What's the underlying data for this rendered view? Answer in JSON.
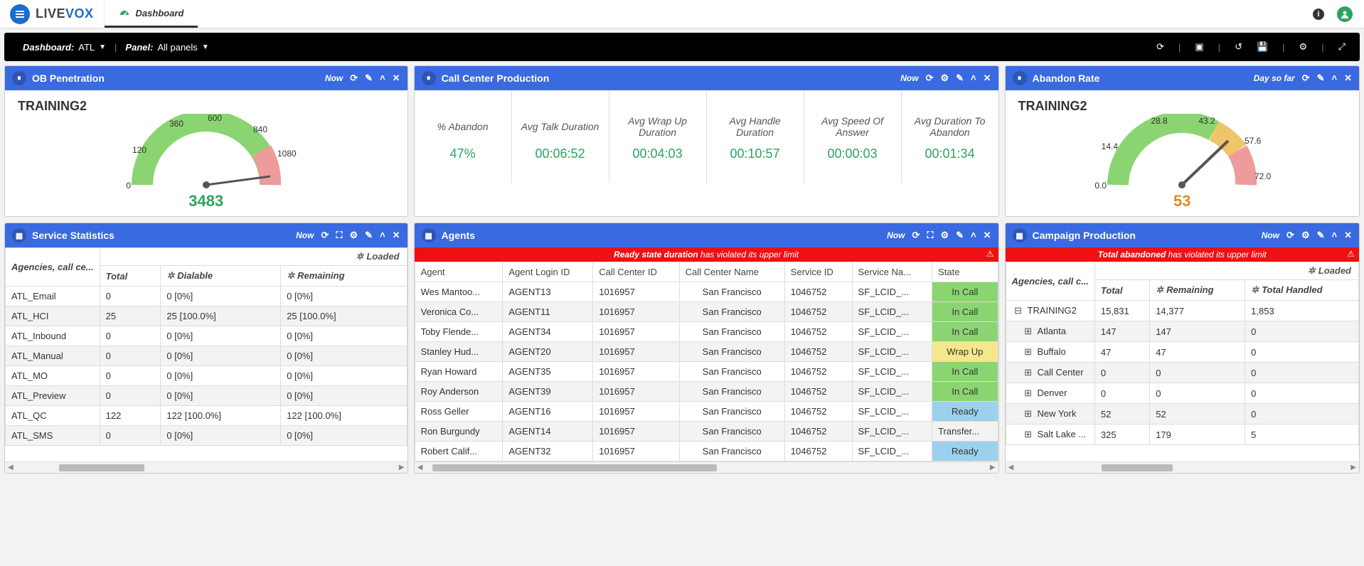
{
  "topnav": {
    "logo_live": "LIVE",
    "logo_vox": "VOX",
    "tab_label": "Dashboard"
  },
  "blackbar": {
    "dash_label": "Dashboard:",
    "dash_val": "ATL",
    "panel_label": "Panel:",
    "panel_val": "All panels"
  },
  "ob_panel": {
    "title": "OB Penetration",
    "time": "Now",
    "gtitle": "TRAINING2",
    "ticks": {
      "t0": "0",
      "t120": "120",
      "t360": "360",
      "t600": "600",
      "t840": "840",
      "t1080": "1080"
    },
    "value": "3483"
  },
  "cc_panel": {
    "title": "Call Center Production",
    "time": "Now",
    "cols": [
      {
        "h": "% Abandon",
        "v": "47%"
      },
      {
        "h": "Avg Talk Duration",
        "v": "00:06:52"
      },
      {
        "h": "Avg Wrap Up Duration",
        "v": "00:04:03"
      },
      {
        "h": "Avg Handle Duration",
        "v": "00:10:57"
      },
      {
        "h": "Avg Speed Of Answer",
        "v": "00:00:03"
      },
      {
        "h": "Avg Duration To Abandon",
        "v": "00:01:34"
      }
    ]
  },
  "ab_panel": {
    "title": "Abandon Rate",
    "time": "Day so far",
    "gtitle": "TRAINING2",
    "ticks": {
      "t0": "0.0",
      "t1": "14.4",
      "t2": "28.8",
      "t3": "43.2",
      "t4": "57.6",
      "t5": "72.0"
    },
    "value": "53"
  },
  "svc_panel": {
    "title": "Service Statistics",
    "time": "Now",
    "loaded": "Loaded",
    "corner": "Agencies, call ce...",
    "cols": {
      "total": "Total",
      "dial": "Dialable",
      "rem": "Remaining"
    },
    "rows": [
      {
        "n": "ATL_Email",
        "t": "0",
        "d": "0 [0%]",
        "r": "0 [0%]"
      },
      {
        "n": "ATL_HCI",
        "t": "25",
        "d": "25 [100.0%]",
        "r": "25 [100.0%]"
      },
      {
        "n": "ATL_Inbound",
        "t": "0",
        "d": "0 [0%]",
        "r": "0 [0%]"
      },
      {
        "n": "ATL_Manual",
        "t": "0",
        "d": "0 [0%]",
        "r": "0 [0%]"
      },
      {
        "n": "ATL_MO",
        "t": "0",
        "d": "0 [0%]",
        "r": "0 [0%]"
      },
      {
        "n": "ATL_Preview",
        "t": "0",
        "d": "0 [0%]",
        "r": "0 [0%]"
      },
      {
        "n": "ATL_QC",
        "t": "122",
        "d": "122 [100.0%]",
        "r": "122 [100.0%]"
      },
      {
        "n": "ATL_SMS",
        "t": "0",
        "d": "0 [0%]",
        "r": "0 [0%]"
      }
    ]
  },
  "ag_panel": {
    "title": "Agents",
    "time": "Now",
    "alert_b": "Ready state duration",
    "alert_r": "has violated its upper limit",
    "cols": {
      "agent": "Agent",
      "login": "Agent Login ID",
      "ccid": "Call Center ID",
      "ccname": "Call Center Name",
      "sid": "Service ID",
      "sname": "Service Na...",
      "state": "State"
    },
    "rows": [
      {
        "a": "Wes Mantoo...",
        "l": "AGENT13",
        "cc": "1016957",
        "cn": "San Francisco",
        "si": "1046752",
        "sn": "SF_LCID_...",
        "st": "In Call",
        "cls": "incell"
      },
      {
        "a": "Veronica Co...",
        "l": "AGENT11",
        "cc": "1016957",
        "cn": "San Francisco",
        "si": "1046752",
        "sn": "SF_LCID_...",
        "st": "In Call",
        "cls": "incell"
      },
      {
        "a": "Toby Flende...",
        "l": "AGENT34",
        "cc": "1016957",
        "cn": "San Francisco",
        "si": "1046752",
        "sn": "SF_LCID_...",
        "st": "In Call",
        "cls": "incell"
      },
      {
        "a": "Stanley Hud...",
        "l": "AGENT20",
        "cc": "1016957",
        "cn": "San Francisco",
        "si": "1046752",
        "sn": "SF_LCID_...",
        "st": "Wrap Up",
        "cls": "wrapup"
      },
      {
        "a": "Ryan Howard",
        "l": "AGENT35",
        "cc": "1016957",
        "cn": "San Francisco",
        "si": "1046752",
        "sn": "SF_LCID_...",
        "st": "In Call",
        "cls": "incell"
      },
      {
        "a": "Roy Anderson",
        "l": "AGENT39",
        "cc": "1016957",
        "cn": "San Francisco",
        "si": "1046752",
        "sn": "SF_LCID_...",
        "st": "In Call",
        "cls": "incell"
      },
      {
        "a": "Ross Geller",
        "l": "AGENT16",
        "cc": "1016957",
        "cn": "San Francisco",
        "si": "1046752",
        "sn": "SF_LCID_...",
        "st": "Ready",
        "cls": "ready"
      },
      {
        "a": "Ron Burgundy",
        "l": "AGENT14",
        "cc": "1016957",
        "cn": "San Francisco",
        "si": "1046752",
        "sn": "SF_LCID_...",
        "st": "Transfer...",
        "cls": ""
      },
      {
        "a": "Robert Calif...",
        "l": "AGENT32",
        "cc": "1016957",
        "cn": "San Francisco",
        "si": "1046752",
        "sn": "SF_LCID_...",
        "st": "Ready",
        "cls": "ready"
      }
    ]
  },
  "camp_panel": {
    "title": "Campaign Production",
    "time": "Now",
    "alert_b": "Total abandoned",
    "alert_r": "has violated its upper limit",
    "loaded": "Loaded",
    "corner": "Agencies, call c...",
    "cols": {
      "total": "Total",
      "rem": "Remaining",
      "th": "Total Handled"
    },
    "rows": [
      {
        "ic": "−",
        "n": "TRAINING2",
        "t": "15,831",
        "r": "14,377",
        "h": "1,853"
      },
      {
        "ic": "+",
        "n": "Atlanta",
        "t": "147",
        "r": "147",
        "h": "0"
      },
      {
        "ic": "+",
        "n": "Buffalo",
        "t": "47",
        "r": "47",
        "h": "0"
      },
      {
        "ic": "+",
        "n": "Call Center",
        "t": "0",
        "r": "0",
        "h": "0"
      },
      {
        "ic": "+",
        "n": "Denver",
        "t": "0",
        "r": "0",
        "h": "0"
      },
      {
        "ic": "+",
        "n": "New York",
        "t": "52",
        "r": "52",
        "h": "0"
      },
      {
        "ic": "+",
        "n": "Salt Lake ...",
        "t": "325",
        "r": "179",
        "h": "5"
      }
    ]
  },
  "chart_data": [
    {
      "type": "gauge",
      "title": "OB Penetration — TRAINING2",
      "range": [
        0,
        1080
      ],
      "ticks": [
        0,
        120,
        360,
        600,
        840,
        1080
      ],
      "zones": [
        {
          "from": 0,
          "to": 960,
          "color": "#8bd472"
        },
        {
          "from": 960,
          "to": 1080,
          "color": "#ed9b9b"
        }
      ],
      "value": 3483,
      "note": "value exceeds scale; needle pegged at max"
    },
    {
      "type": "gauge",
      "title": "Abandon Rate — TRAINING2",
      "range": [
        0,
        72.0
      ],
      "ticks": [
        0.0,
        14.4,
        28.8,
        43.2,
        57.6,
        72.0
      ],
      "zones": [
        {
          "from": 0,
          "to": 43.2,
          "color": "#8bd472"
        },
        {
          "from": 43.2,
          "to": 57.6,
          "color": "#f0c468"
        },
        {
          "from": 57.6,
          "to": 72.0,
          "color": "#ed9b9b"
        }
      ],
      "value": 53
    }
  ]
}
